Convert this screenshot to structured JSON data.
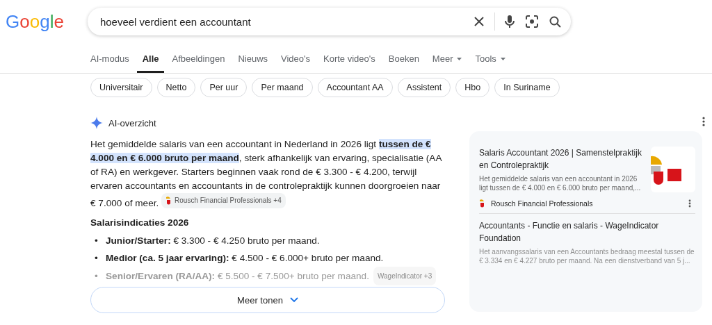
{
  "logo": {
    "text": "Google"
  },
  "search": {
    "value": "hoeveel verdient een accountant"
  },
  "tabs": [
    {
      "label": "AI-modus",
      "selected": false,
      "dropdown": false
    },
    {
      "label": "Alle",
      "selected": true,
      "dropdown": false
    },
    {
      "label": "Afbeeldingen",
      "selected": false,
      "dropdown": false
    },
    {
      "label": "Nieuws",
      "selected": false,
      "dropdown": false
    },
    {
      "label": "Video's",
      "selected": false,
      "dropdown": false
    },
    {
      "label": "Korte video's",
      "selected": false,
      "dropdown": false
    },
    {
      "label": "Boeken",
      "selected": false,
      "dropdown": false
    },
    {
      "label": "Meer",
      "selected": false,
      "dropdown": true
    },
    {
      "label": "Tools",
      "selected": false,
      "dropdown": true
    }
  ],
  "chips": [
    "Universitair",
    "Netto",
    "Per uur",
    "Per maand",
    "Accountant AA",
    "Assistent",
    "Hbo",
    "In Suriname"
  ],
  "ai_overview": {
    "title": "AI-overzicht",
    "paragraph": {
      "before": "Het gemiddelde salaris van een accountant in Nederland in 2026 ligt ",
      "highlight": "tussen de € 4.000 en € 6.000 bruto per maand",
      "after": ", sterk afhankelijk van ervaring, specialisatie (AA of RA) en werkgever. Starters beginnen vaak rond de € 3.300 - € 4.200, terwijl ervaren accountants en accountants in de controlepraktijk kunnen doorgroeien naar € 7.000 of meer.",
      "source_chip": "Rousch Financial Professionals +4"
    },
    "heading": "Salarisindicaties 2026",
    "items": [
      {
        "marker": "•",
        "label": "Junior/Starter:",
        "text": " € 3.300 - € 4.250 bruto per maand.",
        "faded": false
      },
      {
        "marker": "•",
        "label": "Medior (ca. 5 jaar ervaring):",
        "text": " € 4.500 - € 6.000+ bruto per maand.",
        "faded": false
      },
      {
        "marker": "•",
        "label": "Senior/Ervaren (RA/AA):",
        "text": " € 5.500 - € 7.500+ bruto per maand.",
        "faded": true,
        "source_chip": "WageIndicator +3"
      }
    ],
    "more_button": "Meer tonen"
  },
  "sources": [
    {
      "title": "Salaris Accountant 2026 | Samenstelpraktijk en Controlepraktijk",
      "snippet": "Het gemiddelde salaris van een accountant in 2026 ligt tussen de € 4.000 en € 6.000 bruto per maand,...",
      "site": "Rousch Financial Professionals",
      "faded": false
    },
    {
      "title": "Accountants - Functie en salaris - WageIndicator Foundation",
      "snippet": "Het aanvangssalaris van een Accountants bedraag meestal tussen de € 3.334 en € 4.227 bruto per maand. Na een dienstverband van 5 j...",
      "faded": true
    }
  ]
}
